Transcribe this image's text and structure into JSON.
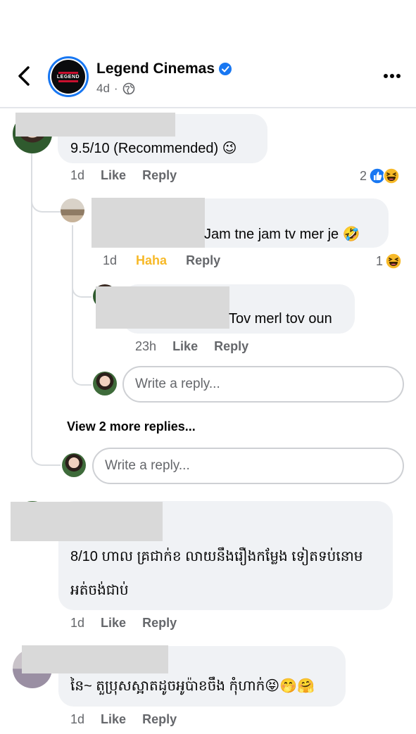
{
  "header": {
    "page_name": "Legend Cinemas",
    "logo_text": "LEGEND",
    "age": "4d",
    "separator": "·"
  },
  "comments": [
    {
      "text": "9.5/10 (Recommended) 😉",
      "time": "1d",
      "like": "Like",
      "reply": "Reply",
      "reaction_count": "2",
      "reactions": [
        "like-reaction-icon",
        "haha-reaction-icon"
      ]
    },
    {
      "text": "Jam tne jam tv mer je 🤣",
      "time": "1d",
      "like": "Haha",
      "reply": "Reply",
      "reaction_count": "1",
      "reactions": [
        "haha-reaction-icon"
      ]
    },
    {
      "text": "Tov merl tov oun",
      "time": "23h",
      "like": "Like",
      "reply": "Reply"
    },
    {
      "text_line1": "8/10 ហាល គ្រជាក់ខ លាយនឹងរឿងកម្លែង ទៀតទប់នោម",
      "text_line2": "អត់ចង់ជាប់",
      "time": "1d",
      "like": "Like",
      "reply": "Reply"
    },
    {
      "text": "នៃ~ តួប្រុសស្អាតដូចអូប៉ាខចឹង កុំហាក់😝🤭🤗",
      "time": "1d",
      "like": "Like",
      "reply": "Reply"
    }
  ],
  "reply_placeholder_nested": "Write a reply...",
  "reply_placeholder": "Write a reply...",
  "view_more": "View 2 more replies...",
  "colors": {
    "accent": "#1877f2",
    "haha": "#f7b928",
    "bubble": "#f0f2f5",
    "muted": "#65676b"
  }
}
